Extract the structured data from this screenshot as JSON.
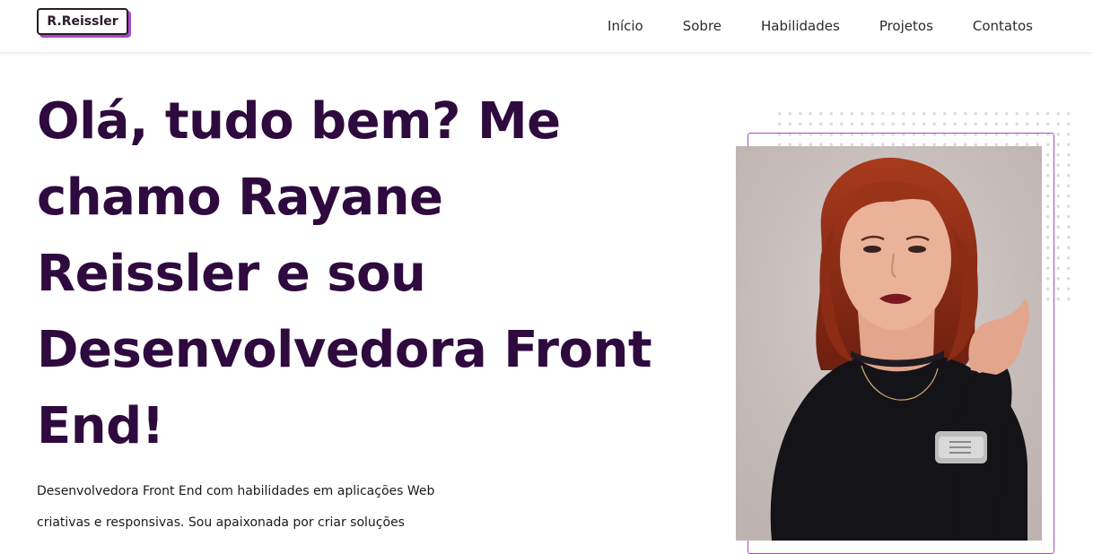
{
  "header": {
    "logo": "R.Reissler",
    "nav": [
      {
        "label": "Início"
      },
      {
        "label": "Sobre"
      },
      {
        "label": "Habilidades"
      },
      {
        "label": "Projetos"
      },
      {
        "label": "Contatos"
      }
    ]
  },
  "hero": {
    "title": "Olá, tudo bem? Me chamo Rayane Reissler e sou Desenvolvedora Front End!",
    "description": "Desenvolvedora Front End com habilidades em aplicações Web criativas e responsivas. Sou apaixonada por criar soluções"
  },
  "colors": {
    "title": "#2e0a3e",
    "accent": "#a64ac9"
  },
  "photo": {
    "subject": "profile-photo"
  }
}
